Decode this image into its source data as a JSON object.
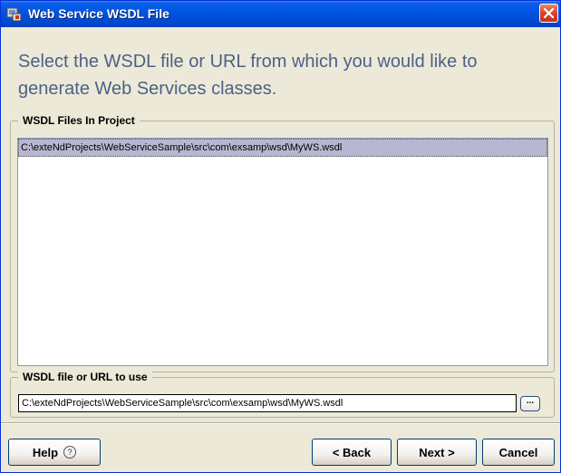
{
  "window": {
    "title": "Web Service WSDL File",
    "heading": "Select the WSDL file or URL from which you would like to generate Web Services classes."
  },
  "wsdl_files_group": {
    "label": "WSDL Files In Project",
    "items": [
      {
        "path": "C:\\exteNdProjects\\WebServiceSample\\src\\com\\exsamp\\wsd\\MyWS.wsdl",
        "selected": true
      }
    ]
  },
  "wsdl_url_group": {
    "label": "WSDL file or URL to use",
    "value": "C:\\exteNdProjects\\WebServiceSample\\src\\com\\exsamp\\wsd\\MyWS.wsdl",
    "browse_label": "..."
  },
  "buttons": {
    "help": "Help",
    "help_icon": "question-circle-icon",
    "back": "< Back",
    "next": "Next >",
    "cancel": "Cancel"
  },
  "colors": {
    "title_bar": "#0054e3",
    "heading_text": "#4d6185",
    "selection": "#b8b7d1",
    "dialog_bg": "#ece9d8"
  }
}
